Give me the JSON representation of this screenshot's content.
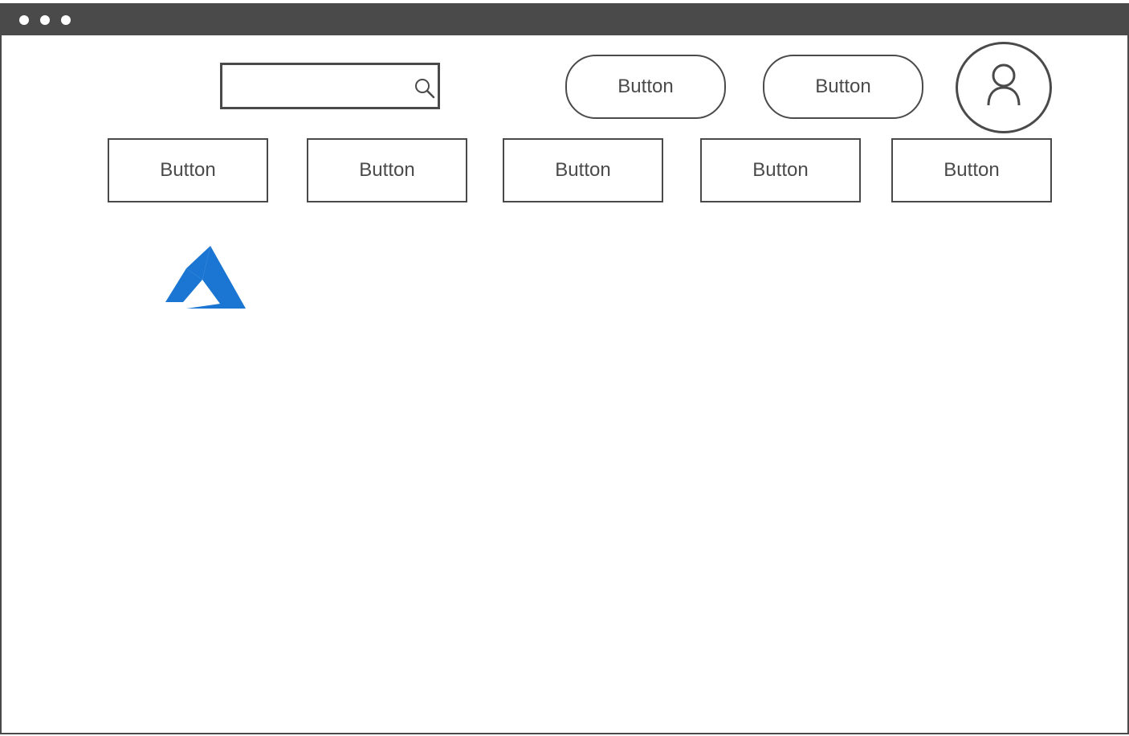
{
  "window": {
    "titlebar_dots": [
      "",
      "",
      ""
    ]
  },
  "header": {
    "search": {
      "value": "",
      "placeholder": "",
      "icon": "search-icon"
    },
    "buttons": [
      {
        "label": "Button"
      },
      {
        "label": "Button"
      }
    ],
    "avatar_icon": "user-icon"
  },
  "nav": {
    "buttons": [
      {
        "label": "Button"
      },
      {
        "label": "Button"
      },
      {
        "label": "Button"
      },
      {
        "label": "Button"
      },
      {
        "label": "Button"
      }
    ]
  },
  "logo": {
    "icon": "azure-logo",
    "color": "#1a76d2"
  },
  "colors": {
    "chrome": "#4a4a4a",
    "background": "#ffffff",
    "accent": "#1a76d2"
  }
}
